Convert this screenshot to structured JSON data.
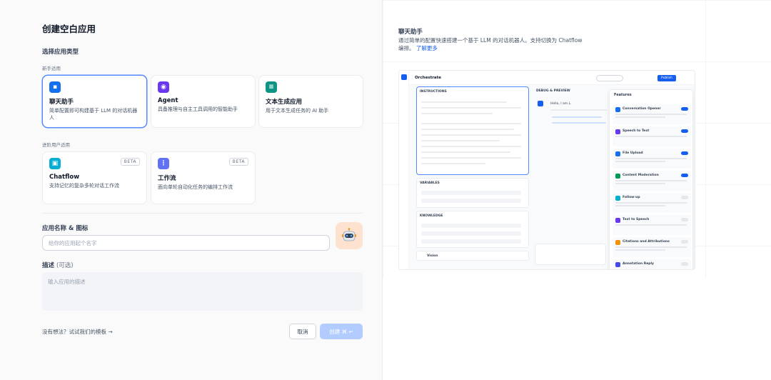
{
  "page": {
    "title": "创建空白应用",
    "app_type_label": "选择应用类型",
    "beginner_label": "新手适用",
    "advanced_label": "进阶用户适用"
  },
  "app_types": [
    {
      "name": "聊天助手",
      "desc": "简单配置即可构建基于 LLM 的对话机器人",
      "color": "#1570ef",
      "icon": "chat-icon"
    },
    {
      "name": "Agent",
      "desc": "具备推理与自主工具调用的智能助手",
      "color": "#6938ef",
      "icon": "agent-icon"
    },
    {
      "name": "文本生成应用",
      "desc": "用于文本生成任务的 AI 助手",
      "color": "#0e9384",
      "icon": "text-gen-icon"
    },
    {
      "name": "Chatflow",
      "desc": "支持记忆的复杂多轮对话工作流",
      "color": "#06aed4",
      "icon": "chatflow-icon",
      "badge": "BETA"
    },
    {
      "name": "工作流",
      "desc": "面向单轮自动化任务的编排工作流",
      "color": "#6172f3",
      "icon": "workflow-icon",
      "badge": "BETA"
    }
  ],
  "form": {
    "name_label": "应用名称 & 图标",
    "name_placeholder": "给你的应用起个名字",
    "desc_label": "描述",
    "desc_optional": "(可选)",
    "desc_placeholder": "输入应用的描述"
  },
  "footer": {
    "template_hint": "没有想法？试试我们的模板 →",
    "cancel_label": "取消",
    "create_label": "创建 ⌘ ↵"
  },
  "preview": {
    "title": "聊天助手",
    "desc": "通过简单的配置快速搭建一个基于 LLM 的对话机器人。支持切换为 Chatflow 编排。",
    "learn_more": "了解更多",
    "orchestrate": "Orchestrate",
    "instructions": "INSTRUCTIONS",
    "debug": "DEBUG & PREVIEW",
    "variables": "VARIABLES",
    "knowledge": "KNOWLEDGE",
    "vision": "Vision",
    "features_title": "Features",
    "features": [
      {
        "name": "Conversation Opener",
        "on": true,
        "color": "#1570ef"
      },
      {
        "name": "Speech to Text",
        "on": true,
        "color": "#6938ef"
      },
      {
        "name": "File Upload",
        "on": true,
        "color": "#1570ef"
      },
      {
        "name": "Content Moderation",
        "on": true,
        "color": "#039855"
      },
      {
        "name": "Follow-up",
        "on": false,
        "color": "#06aed4"
      },
      {
        "name": "Text to Speech",
        "on": false,
        "color": "#6938ef"
      },
      {
        "name": "Citations and Attributions",
        "on": false,
        "color": "#f79009"
      },
      {
        "name": "Annotation Reply",
        "on": false,
        "color": "#444ce7"
      }
    ],
    "chat_greeting": "Hello, I am L.",
    "publish": "Publish"
  }
}
